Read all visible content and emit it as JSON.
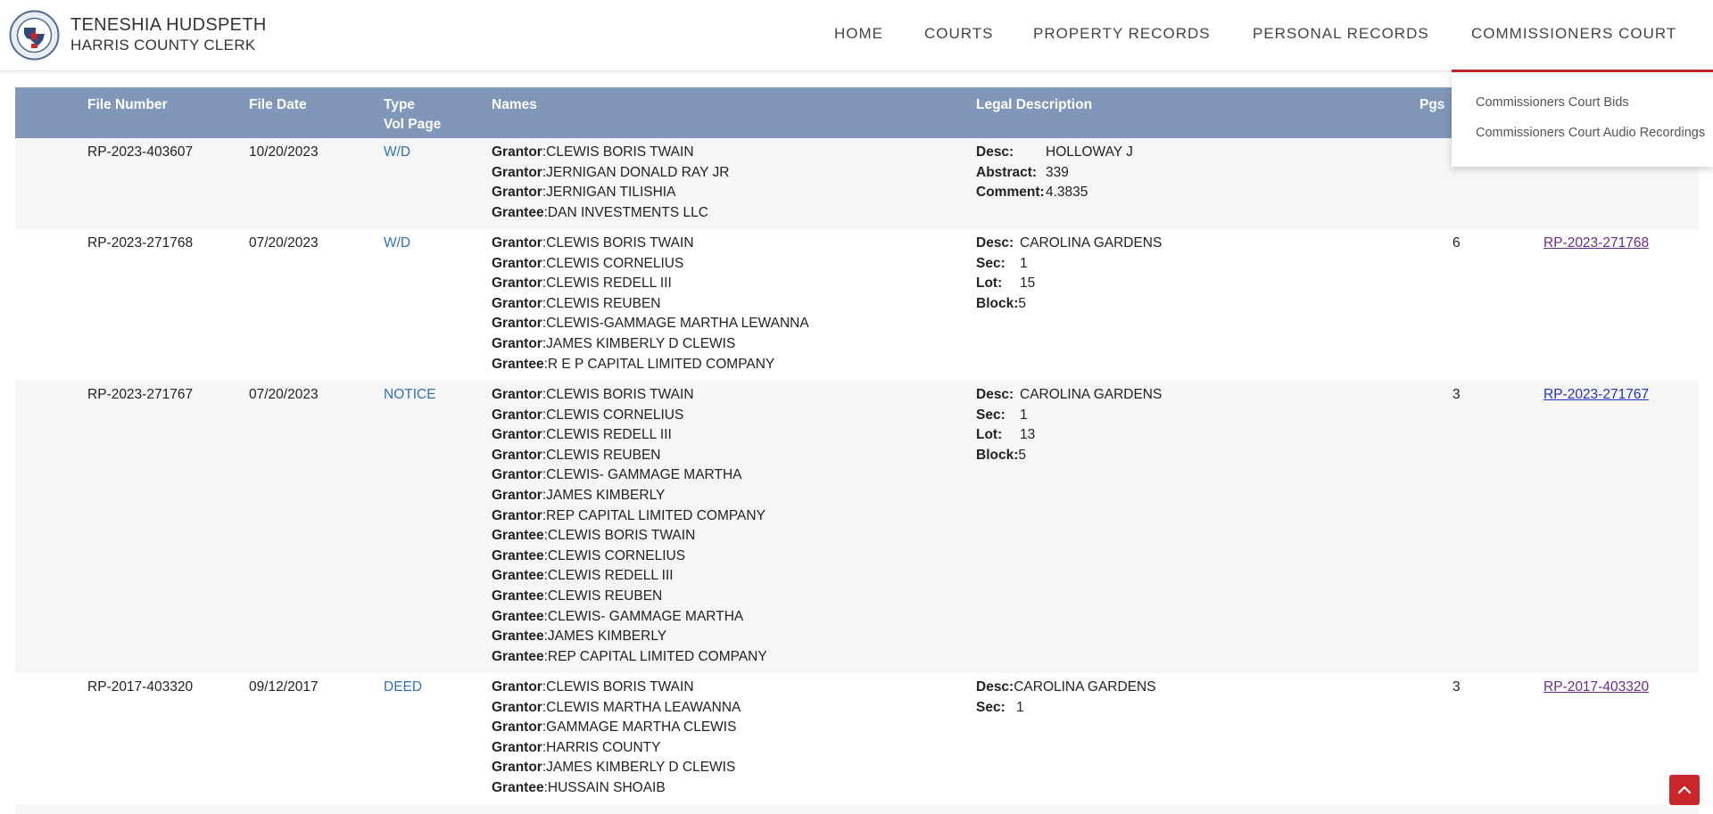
{
  "header": {
    "brand_name": "TENESHIA HUDSPETH",
    "brand_sub": "HARRIS COUNTY CLERK",
    "nav": [
      "HOME",
      "COURTS",
      "PROPERTY RECORDS",
      "PERSONAL RECORDS",
      "COMMISSIONERS COURT"
    ],
    "dropdown": [
      "Commissioners Court Bids",
      "Commissioners Court Audio Recordings"
    ],
    "accent_color": "#c3262d"
  },
  "table": {
    "headers": {
      "file_number": "File Number",
      "file_date": "File Date",
      "type": "Type",
      "vol_page": "Vol Page",
      "names": "Names",
      "legal": "Legal Description",
      "pgs": "Pgs"
    },
    "rows": [
      {
        "file_number": "RP-2023-403607",
        "file_date": "10/20/2023",
        "type": "W/D",
        "names": [
          {
            "role": "Grantor",
            "name": "CLEWIS BORIS TWAIN"
          },
          {
            "role": "Grantor",
            "name": "JERNIGAN DONALD RAY JR"
          },
          {
            "role": "Grantor",
            "name": "JERNIGAN TILISHIA"
          },
          {
            "role": "Grantee",
            "name": "DAN INVESTMENTS LLC"
          }
        ],
        "legal": [
          {
            "label": "Desc:",
            "value": "HOLLOWAY J"
          },
          {
            "label": "Abstract:",
            "value": "339"
          },
          {
            "label": "Comment:",
            "value": "4.3835"
          }
        ],
        "pgs": "",
        "link": ""
      },
      {
        "file_number": "RP-2023-271768",
        "file_date": "07/20/2023",
        "type": "W/D",
        "names": [
          {
            "role": "Grantor",
            "name": "CLEWIS BORIS TWAIN"
          },
          {
            "role": "Grantor",
            "name": "CLEWIS CORNELIUS"
          },
          {
            "role": "Grantor",
            "name": "CLEWIS REDELL III"
          },
          {
            "role": "Grantor",
            "name": "CLEWIS REUBEN"
          },
          {
            "role": "Grantor",
            "name": "CLEWIS-GAMMAGE MARTHA LEWANNA"
          },
          {
            "role": "Grantor",
            "name": "JAMES KIMBERLY D CLEWIS"
          },
          {
            "role": "Grantee",
            "name": "R E P CAPITAL LIMITED COMPANY"
          }
        ],
        "legal": [
          {
            "label": "Desc:",
            "value": "CAROLINA GARDENS"
          },
          {
            "label": "Sec:",
            "value": "1"
          },
          {
            "label": "Lot:",
            "value": "15"
          },
          {
            "label": "Block:",
            "value": "5"
          }
        ],
        "pgs": "6",
        "link": "RP-2023-271768"
      },
      {
        "file_number": "RP-2023-271767",
        "file_date": "07/20/2023",
        "type": "NOTICE",
        "names": [
          {
            "role": "Grantor",
            "name": "CLEWIS BORIS TWAIN"
          },
          {
            "role": "Grantor",
            "name": "CLEWIS CORNELIUS"
          },
          {
            "role": "Grantor",
            "name": "CLEWIS REDELL III"
          },
          {
            "role": "Grantor",
            "name": "CLEWIS REUBEN"
          },
          {
            "role": "Grantor",
            "name": "CLEWIS- GAMMAGE MARTHA"
          },
          {
            "role": "Grantor",
            "name": "JAMES KIMBERLY"
          },
          {
            "role": "Grantor",
            "name": "REP CAPITAL LIMITED COMPANY"
          },
          {
            "role": "Grantee",
            "name": "CLEWIS BORIS TWAIN"
          },
          {
            "role": "Grantee",
            "name": "CLEWIS CORNELIUS"
          },
          {
            "role": "Grantee",
            "name": "CLEWIS REDELL III"
          },
          {
            "role": "Grantee",
            "name": "CLEWIS REUBEN"
          },
          {
            "role": "Grantee",
            "name": "CLEWIS- GAMMAGE MARTHA"
          },
          {
            "role": "Grantee",
            "name": "JAMES KIMBERLY"
          },
          {
            "role": "Grantee",
            "name": "REP CAPITAL LIMITED COMPANY"
          }
        ],
        "legal": [
          {
            "label": "Desc:",
            "value": "CAROLINA GARDENS"
          },
          {
            "label": "Sec:",
            "value": "1"
          },
          {
            "label": "Lot:",
            "value": "13"
          },
          {
            "label": "Block:",
            "value": "5"
          }
        ],
        "pgs": "3",
        "link": "RP-2023-271767"
      },
      {
        "file_number": "RP-2017-403320",
        "file_date": "09/12/2017",
        "type": "DEED",
        "names": [
          {
            "role": "Grantor",
            "name": "CLEWIS BORIS TWAIN"
          },
          {
            "role": "Grantor",
            "name": "CLEWIS MARTHA LEAWANNA"
          },
          {
            "role": "Grantor",
            "name": "GAMMAGE MARTHA CLEWIS"
          },
          {
            "role": "Grantor",
            "name": "HARRIS COUNTY"
          },
          {
            "role": "Grantor",
            "name": "JAMES KIMBERLY D CLEWIS"
          },
          {
            "role": "Grantee",
            "name": "HUSSAIN SHOAIB"
          }
        ],
        "legal": [
          {
            "label": "Desc:",
            "value": "CAROLINA GARDENS"
          },
          {
            "label": "Sec:",
            "value": "1"
          }
        ],
        "pgs": "3",
        "link": "RP-2017-403320"
      }
    ]
  }
}
